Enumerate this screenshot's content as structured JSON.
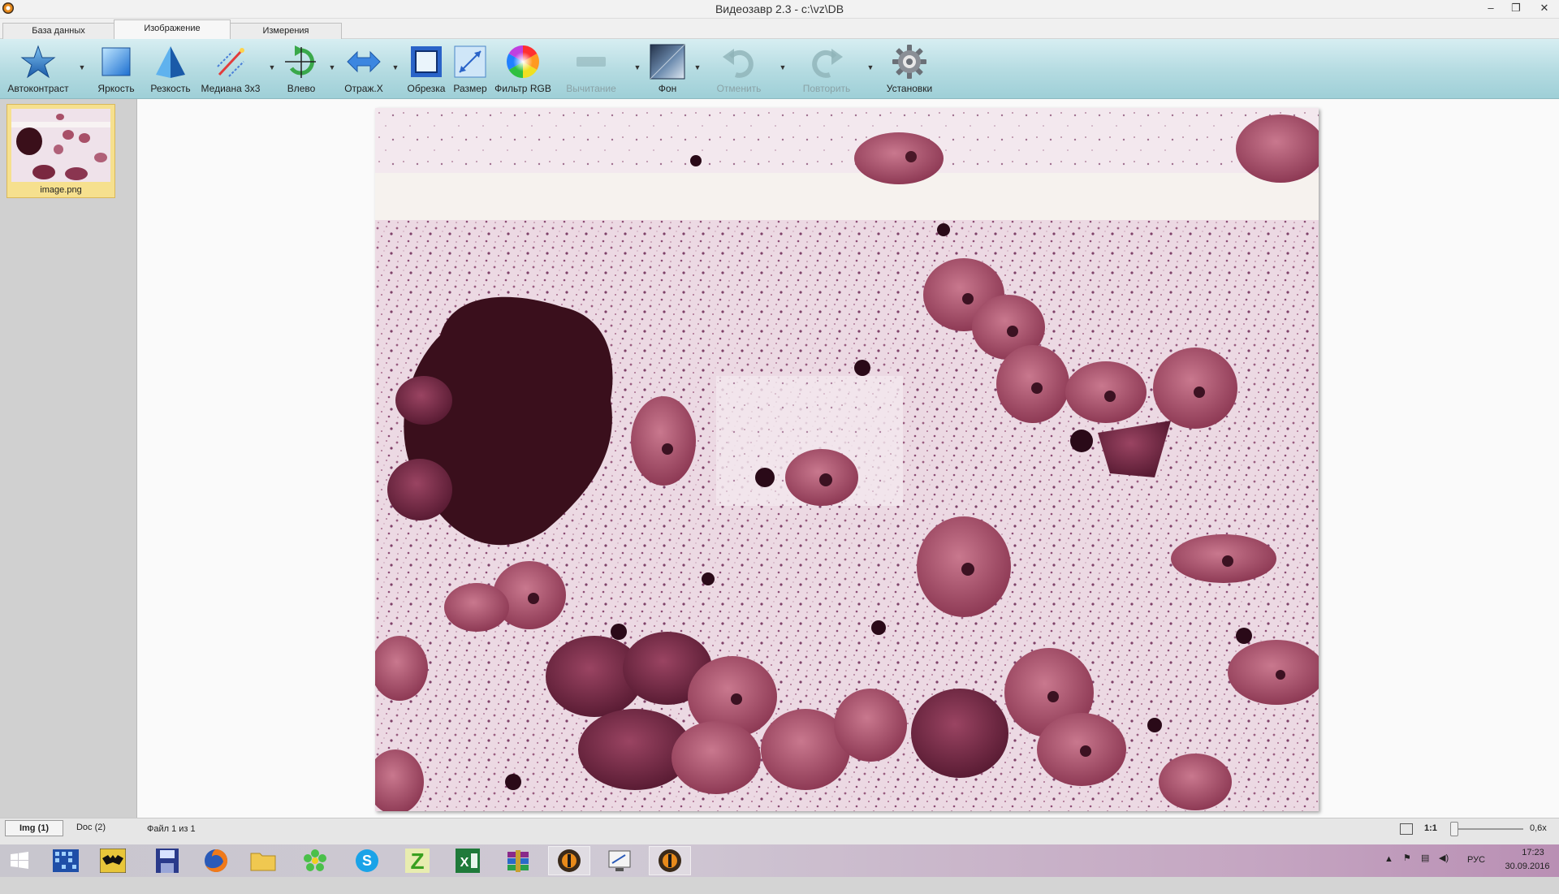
{
  "window": {
    "title": "Видеозавр 2.3 - c:\\vz\\DB",
    "minimize": "–",
    "maximize": "❐",
    "close": "✕"
  },
  "tabs": [
    {
      "label": "База данных"
    },
    {
      "label": "Изображение",
      "active": true
    },
    {
      "label": "Измерения"
    }
  ],
  "toolbar": {
    "autocontrast": "Автоконтраст",
    "brightness": "Яркость",
    "sharpness": "Резкость",
    "median": "Медиана 3х3",
    "rotate_left": "Влево",
    "mirror_x": "Отраж.X",
    "crop": "Обрезка",
    "resize": "Размер",
    "rgb_filter": "Фильтр RGB",
    "subtract": "Вычитание",
    "background": "Фон",
    "undo": "Отменить",
    "redo": "Повторить",
    "settings": "Установки"
  },
  "gallery": {
    "items": [
      {
        "name": "image.png"
      }
    ]
  },
  "bottom_tabs": {
    "img": "Img (1)",
    "doc": "Doc (2)"
  },
  "status": {
    "file_counter": "Файл 1 из 1",
    "ratio_label": "1:1",
    "zoom_value": "0,6x",
    "zoom_level": 0.0
  },
  "taskbar": {
    "language": "РУС",
    "time": "17:23",
    "date": "30.09.2016"
  },
  "colors": {
    "ribbon": "#b4dbe1",
    "thumb_highlight": "#f6e08e",
    "taskbar_accent": "#b98fb4"
  }
}
